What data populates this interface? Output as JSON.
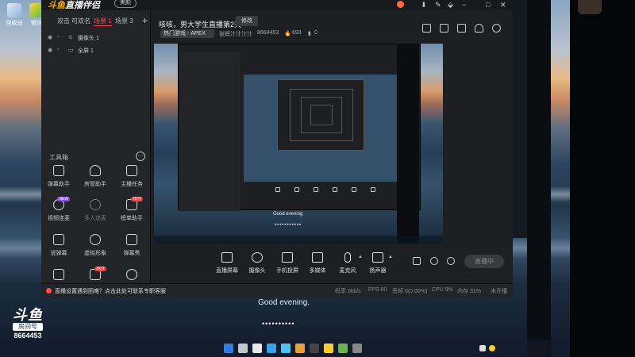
{
  "desktop": {
    "icons": [
      {
        "label": "回收站"
      },
      {
        "label": "微信"
      }
    ],
    "greeting": "Good evening.",
    "dots": "••••••••••",
    "watermark": {
      "logo": "斗鱼",
      "sub": "房间号",
      "room": "8664453"
    }
  },
  "app": {
    "brand_prefix": "斗鱼",
    "brand_rest": "直播伴侣",
    "version_pill": "美颜",
    "window_controls": [
      "−",
      "□",
      "✕"
    ],
    "scenes": {
      "tabs": [
        "双击",
        "可双名",
        "场景 1",
        "场景 3"
      ],
      "active_index": 2,
      "add": "+"
    },
    "sources": [
      {
        "label": "摄像头 1"
      },
      {
        "label": "全屏 1"
      }
    ],
    "toolbox": {
      "title": "工具箱",
      "more": "···",
      "tools": [
        {
          "label": "弹幕助手",
          "badge": ""
        },
        {
          "label": "房管助手",
          "badge": ""
        },
        {
          "label": "主播任务",
          "badge": ""
        },
        {
          "label": "视频连麦",
          "badge": "NEW"
        },
        {
          "label": "多人连麦",
          "badge": ""
        },
        {
          "label": "榜单助手",
          "badge": "HOT"
        },
        {
          "label": "说弹幕",
          "badge": ""
        },
        {
          "label": "虚拟形象",
          "badge": ""
        },
        {
          "label": "弹幕秀",
          "badge": ""
        },
        {
          "label": "",
          "badge": ""
        },
        {
          "label": "",
          "badge": "HOT"
        },
        {
          "label": "",
          "badge": ""
        }
      ]
    },
    "header": {
      "title": "咳咳，男大学生直播第2天",
      "edit": "修改",
      "category": "热门游戏 - APEX",
      "meta_1": "张辉汁汁汁汁",
      "room_id": "8664453",
      "hot_count": "693",
      "followers": "0"
    },
    "preview": {
      "greeting": "Good evening",
      "dots": "•••••••••••"
    },
    "controls": [
      {
        "label": "直播屏幕"
      },
      {
        "label": "摄像头"
      },
      {
        "label": "手机投屏"
      },
      {
        "label": "多媒体"
      },
      {
        "label": "麦克风"
      },
      {
        "label": "扬声器"
      }
    ],
    "live_button": "直播中",
    "status": {
      "notice": "直播设置遇到困难？点击此处可联系专职客服",
      "items": [
        "码率 0kb/s",
        "FPS 60",
        "丢帧 0(0.00%)",
        "CPU 9%",
        "内存 31%",
        "未开播"
      ]
    }
  },
  "colors": {
    "accent": "#ff4d4f",
    "panel": "#232427",
    "window": "#1e1f22",
    "brand": "#ffb000"
  }
}
